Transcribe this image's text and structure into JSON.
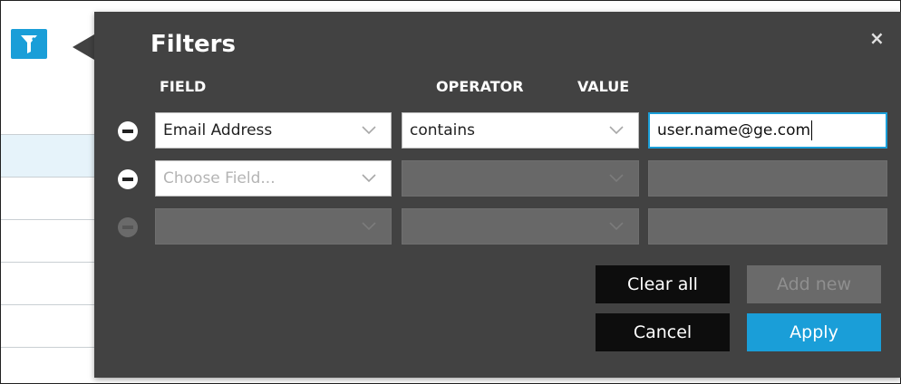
{
  "filters_panel": {
    "title": "Filters",
    "close_label": "×",
    "headers": {
      "field": "FIELD",
      "operator": "OPERATOR",
      "value": "VALUE"
    },
    "rows": [
      {
        "field": "Email Address",
        "operator": "contains",
        "value": "user.name@ge.com"
      },
      {
        "field_placeholder": "Choose Field..."
      },
      {}
    ],
    "buttons": {
      "clear_all": "Clear all",
      "add_new": "Add new",
      "cancel": "Cancel",
      "apply": "Apply"
    }
  },
  "colors": {
    "accent": "#1a9ed8",
    "panel_bg": "#424242",
    "disabled": "#686868",
    "dark_button": "#0d0d0d"
  }
}
